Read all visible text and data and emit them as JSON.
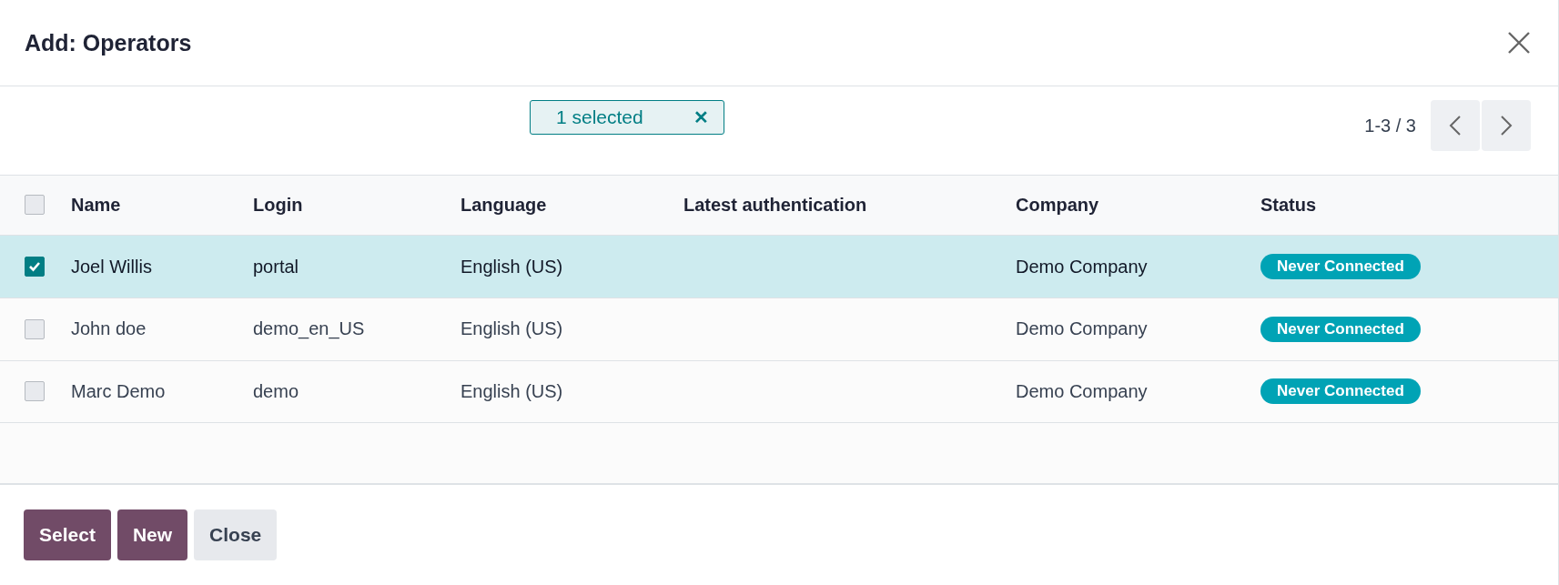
{
  "dialog": {
    "title": "Add: Operators"
  },
  "selection": {
    "label": "1 selected",
    "clear": "✕"
  },
  "pager": {
    "range": "1-3 / 3"
  },
  "table": {
    "select_all_checked": false,
    "columns": [
      "Name",
      "Login",
      "Language",
      "Latest authentication",
      "Company",
      "Status"
    ],
    "rows": [
      {
        "selected": true,
        "name": "Joel Willis",
        "login": "portal",
        "language": "English (US)",
        "latest_authentication": "",
        "company": "Demo Company",
        "status": "Never Connected"
      },
      {
        "selected": false,
        "name": "John doe",
        "login": "demo_en_US",
        "language": "English (US)",
        "latest_authentication": "",
        "company": "Demo Company",
        "status": "Never Connected"
      },
      {
        "selected": false,
        "name": "Marc Demo",
        "login": "demo",
        "language": "English (US)",
        "latest_authentication": "",
        "company": "Demo Company",
        "status": "Never Connected"
      }
    ]
  },
  "buttons": [
    {
      "label": "Select",
      "kind": "primary"
    },
    {
      "label": "New",
      "kind": "primary"
    },
    {
      "label": "Close",
      "kind": "secondary"
    }
  ]
}
